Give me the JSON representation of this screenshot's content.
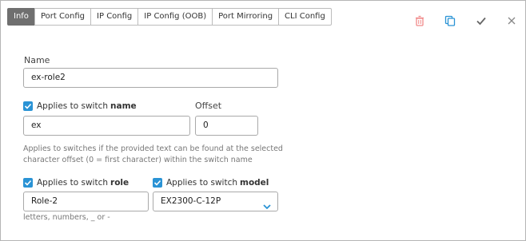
{
  "tabs": [
    {
      "label": "Info",
      "active": true
    },
    {
      "label": "Port Config",
      "active": false
    },
    {
      "label": "IP Config",
      "active": false
    },
    {
      "label": "IP Config (OOB)",
      "active": false
    },
    {
      "label": "Port Mirroring",
      "active": false
    },
    {
      "label": "CLI Config",
      "active": false
    }
  ],
  "toolbar": {
    "icons": [
      "trash-icon",
      "copy-icon",
      "check-icon",
      "close-icon"
    ],
    "colors": {
      "delete": "#f08a8a",
      "copy": "#2a93d5",
      "check": "#666666",
      "close": "#888888"
    }
  },
  "form": {
    "name_label": "Name",
    "name_value": "ex-role2",
    "applies_name_prefix": "Applies to switch",
    "applies_name_bold": "name",
    "offset_label": "Offset",
    "name_match_value": "ex",
    "offset_value": "0",
    "help_line1": "Applies to switches if the provided text can be found at the selected",
    "help_line2": "character offset (0 = first character) within the switch name",
    "applies_role_prefix": "Applies to switch",
    "applies_role_bold": "role",
    "applies_model_prefix": "Applies to switch",
    "applies_model_bold": "model",
    "role_value": "Role-2",
    "model_value": "EX2300-C-12P",
    "role_help": "letters, numbers, _ or -"
  },
  "accent_color": "#2a93d5"
}
